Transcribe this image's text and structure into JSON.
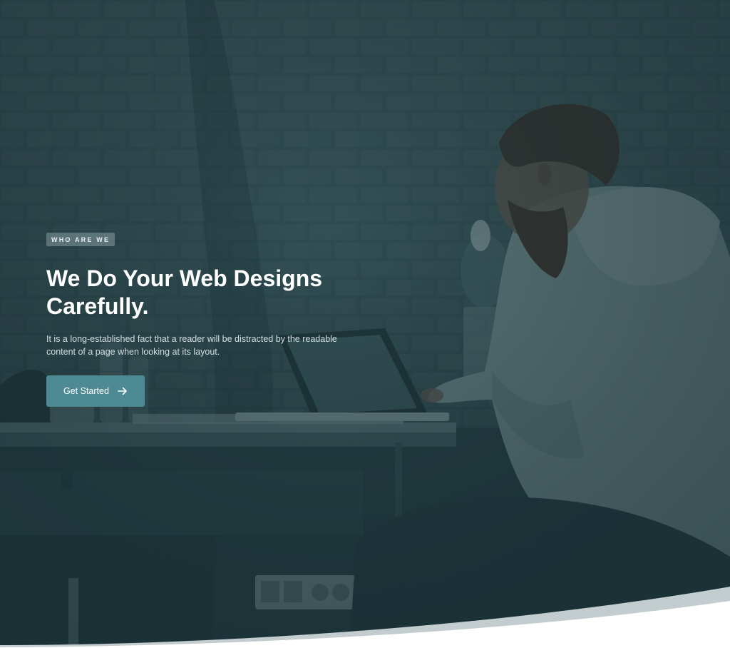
{
  "hero": {
    "eyebrow": "WHO ARE WE",
    "headline": "We Do Your Web Designs Carefully.",
    "description": "It is a long-established fact that a reader will be distracted by the readable content of a page when looking at its layout.",
    "cta_label": "Get Started",
    "cta_icon": "arrow-right-icon",
    "overlay_color": "#26444b",
    "button_color": "#4d8a93"
  }
}
